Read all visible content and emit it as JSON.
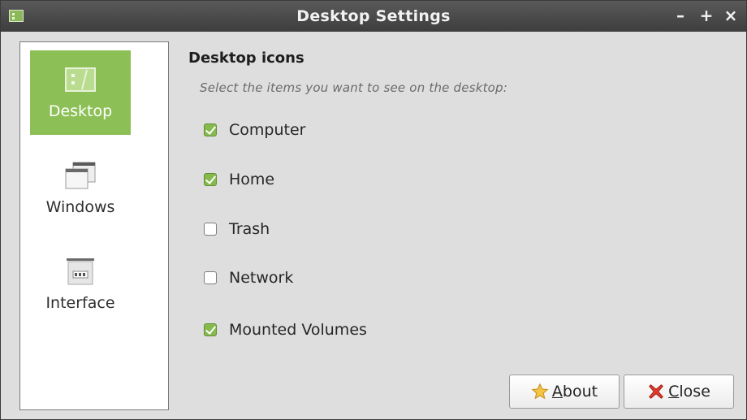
{
  "window": {
    "title": "Desktop Settings",
    "controls": {
      "minimize": "–",
      "maximize": "+",
      "close": "×"
    }
  },
  "sidebar": {
    "items": [
      {
        "label": "Desktop",
        "icon": "desktop-icon",
        "active": true
      },
      {
        "label": "Windows",
        "icon": "windows-icon",
        "active": false
      },
      {
        "label": "Interface",
        "icon": "interface-icon",
        "active": false
      }
    ]
  },
  "content": {
    "heading": "Desktop icons",
    "hint": "Select the items you want to see on the desktop:",
    "options": [
      {
        "label": "Computer",
        "checked": true
      },
      {
        "label": "Home",
        "checked": true
      },
      {
        "label": "Trash",
        "checked": false
      },
      {
        "label": "Network",
        "checked": false
      },
      {
        "label": "Mounted Volumes",
        "checked": true
      }
    ]
  },
  "buttons": {
    "about": {
      "mnemonic": "A",
      "rest": "bout",
      "icon": "star-icon"
    },
    "close": {
      "mnemonic": "C",
      "rest": "lose",
      "icon": "red-x-icon"
    }
  },
  "colors": {
    "accent": "#8cbf55",
    "titlebar": "#4a4a4a"
  }
}
